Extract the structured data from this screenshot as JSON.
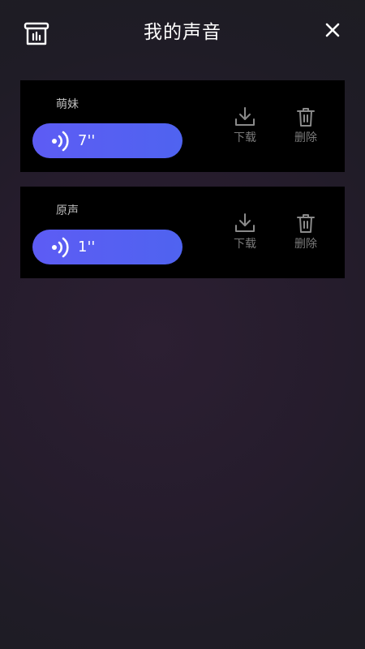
{
  "header": {
    "title": "我的声音",
    "left_icon": "voice-box-icon",
    "close_icon": "close-icon"
  },
  "voices": [
    {
      "name": "萌妹",
      "duration": "7''",
      "download_label": "下载",
      "delete_label": "删除"
    },
    {
      "name": "原声",
      "duration": "1''",
      "download_label": "下载",
      "delete_label": "删除"
    }
  ],
  "colors": {
    "accent": "#5a5ef4",
    "card_bg": "#000000",
    "muted_text": "#7a7a7a"
  }
}
